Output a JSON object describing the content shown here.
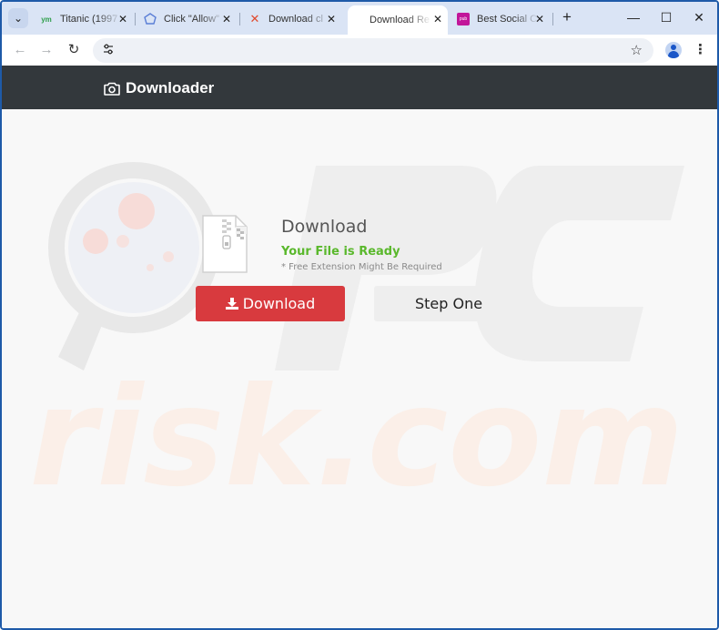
{
  "browser": {
    "tabs": [
      {
        "label": "Titanic (1997",
        "icon": "movie-site-icon",
        "active": false
      },
      {
        "label": "Click \"Allow\"",
        "icon": "cloud-icon",
        "active": false
      },
      {
        "label": "Download cl",
        "icon": "x-logo-icon",
        "active": false
      },
      {
        "label": "Download Re",
        "icon": "none",
        "active": true
      },
      {
        "label": "Best Social C",
        "icon": "purple-site-icon",
        "active": false
      }
    ],
    "url": "",
    "colors": {
      "tabstrip": "#dae4f5",
      "frame": "#1e5aa8"
    }
  },
  "site": {
    "brand": "Downloader",
    "navbar_color": "#33383c"
  },
  "card": {
    "title": "Download",
    "ready_text": "Your File is Ready",
    "note": "* Free Extension Might Be Required",
    "download_button": "Download",
    "step_button": "Step One",
    "colors": {
      "download": "#d83a3e",
      "ready": "#5ab82c"
    }
  },
  "watermark": {
    "text": "risk.com"
  }
}
